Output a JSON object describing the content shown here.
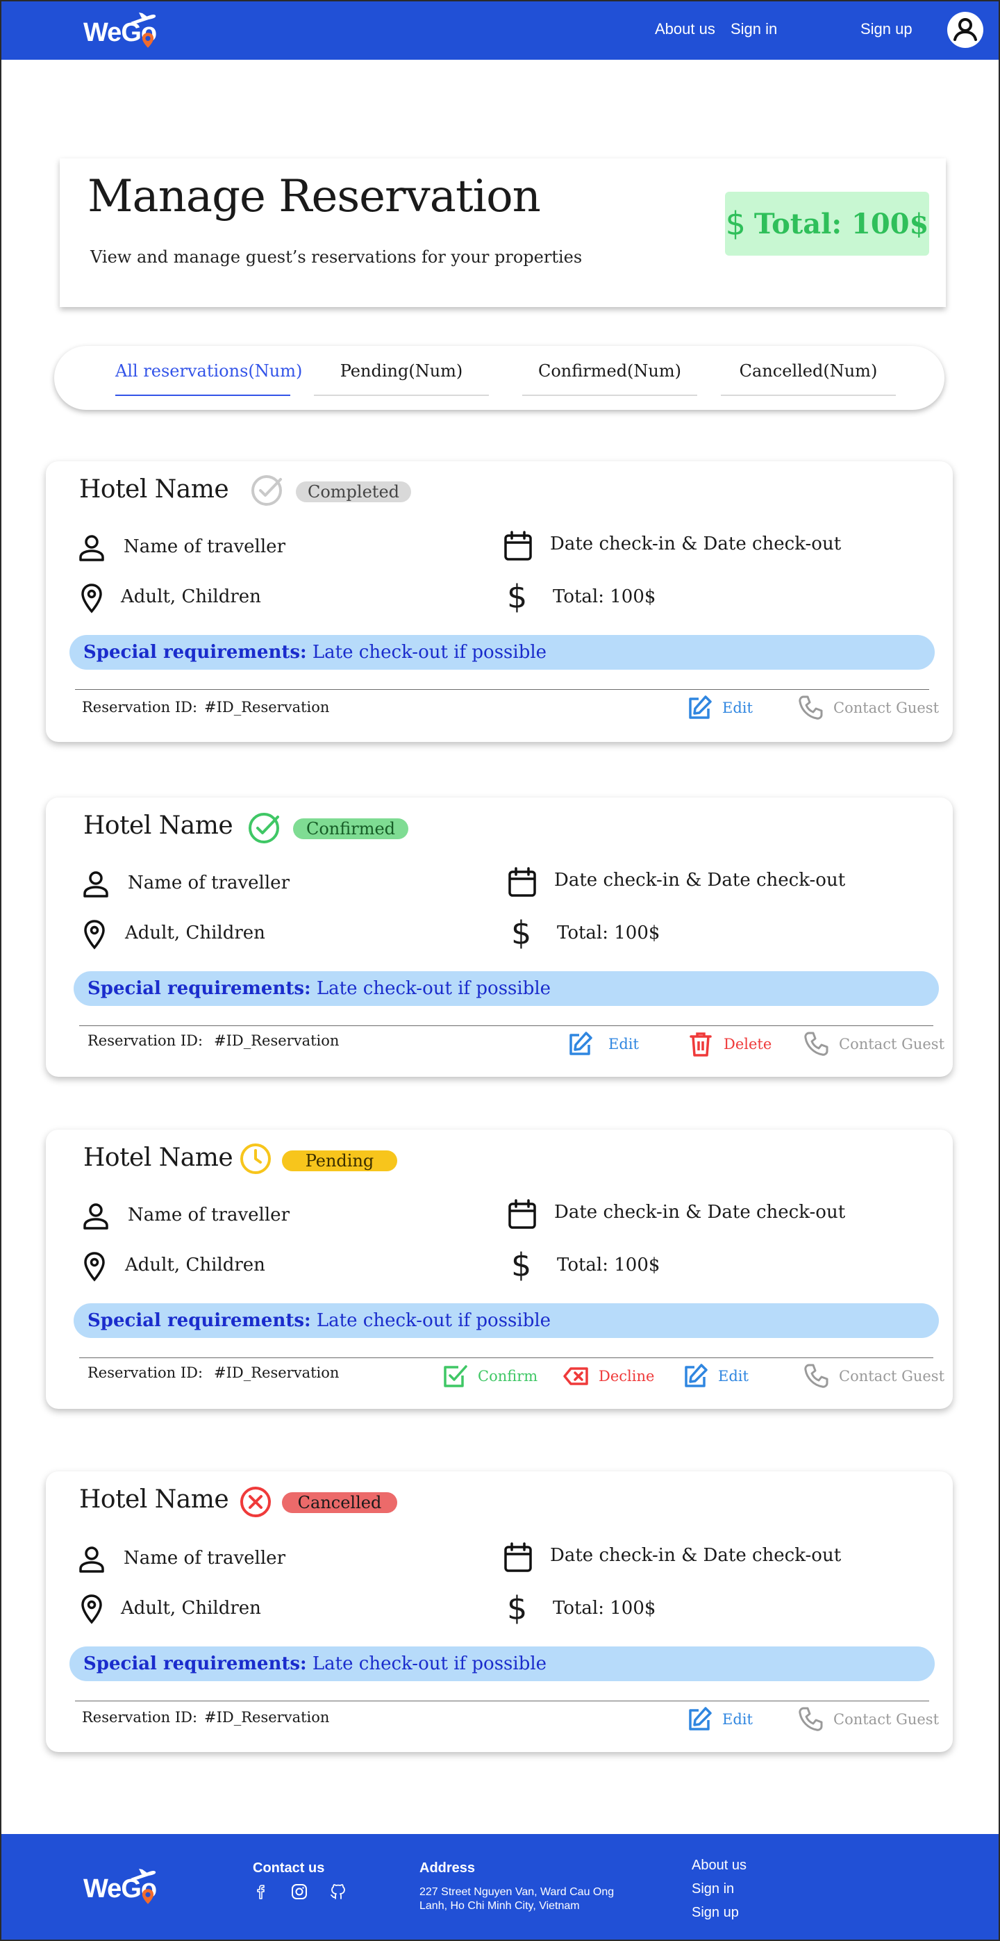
{
  "brand": {
    "logo_text": "WeGo"
  },
  "header": {
    "nav": [
      "About us",
      "Sign in",
      "Sign up"
    ],
    "profile_icon": "user-circle-icon",
    "background_color": "#2150d6"
  },
  "summary": {
    "title": "Manage Reservation",
    "subtitle": "View and manage guest’s reservations for your properties",
    "total": "Total: 100$"
  },
  "tabs": [
    {
      "label": "All reservations(Num)",
      "active": true
    },
    {
      "label": "Pending(Num)",
      "active": false
    },
    {
      "label": "Confirmed(Num)",
      "active": false
    },
    {
      "label": "Cancelled(Num)",
      "active": false
    }
  ],
  "reservations": [
    {
      "hotel_name": "Hotel Name",
      "status": "Completed",
      "status_color": "#d9d9d9",
      "status_icon": "check-circle-icon",
      "traveller": "Name of traveller",
      "dates": "Date check-in & Date check-out",
      "guests": "Adult, Children",
      "total": "Total: 100$",
      "special_label": "Special requirements:",
      "special_text": "Late check-out if possible",
      "id_label": "Reservation ID:",
      "id_value": "#ID_Reservation",
      "actions": [
        "Edit",
        "Contact Guest"
      ]
    },
    {
      "hotel_name": "Hotel Name",
      "status": "Confirmed",
      "status_color": "#7fdc93",
      "status_icon": "check-circle-icon",
      "traveller": "Name of traveller",
      "dates": "Date check-in & Date check-out",
      "guests": "Adult, Children",
      "total": "Total: 100$",
      "special_label": "Special requirements:",
      "special_text": "Late check-out if possible",
      "id_label": "Reservation ID:",
      "id_value": "#ID_Reservation",
      "actions": [
        "Edit",
        "Delete",
        "Contact Guest"
      ]
    },
    {
      "hotel_name": "Hotel Name",
      "status": "Pending",
      "status_color": "#f7c51c",
      "status_icon": "clock-icon",
      "traveller": "Name of traveller",
      "dates": "Date check-in & Date check-out",
      "guests": "Adult, Children",
      "total": "Total: 100$",
      "special_label": "Special requirements:",
      "special_text": "Late check-out if possible",
      "id_label": "Reservation ID:",
      "id_value": "#ID_Reservation",
      "actions": [
        "Confirm",
        "Decline",
        "Edit",
        "Contact Guest"
      ]
    },
    {
      "hotel_name": "Hotel Name",
      "status": "Cancelled",
      "status_color": "#ec6a6a",
      "status_icon": "x-circle-icon",
      "traveller": "Name of traveller",
      "dates": "Date check-in & Date check-out",
      "guests": "Adult, Children",
      "total": "Total: 100$",
      "special_label": "Special requirements:",
      "special_text": "Late check-out if possible",
      "id_label": "Reservation ID:",
      "id_value": "#ID_Reservation",
      "actions": [
        "Edit",
        "Contact Guest"
      ]
    }
  ],
  "footer": {
    "contact_heading": "Contact us",
    "social_icons": [
      "facebook-icon",
      "instagram-icon",
      "github-icon"
    ],
    "address_heading": "Address",
    "address": "227 Street Nguyen Van, Ward Cau Ong Lanh, Ho Chi Minh City, Vietnam",
    "links": [
      "About us",
      "Sign in",
      "Sign up"
    ]
  }
}
